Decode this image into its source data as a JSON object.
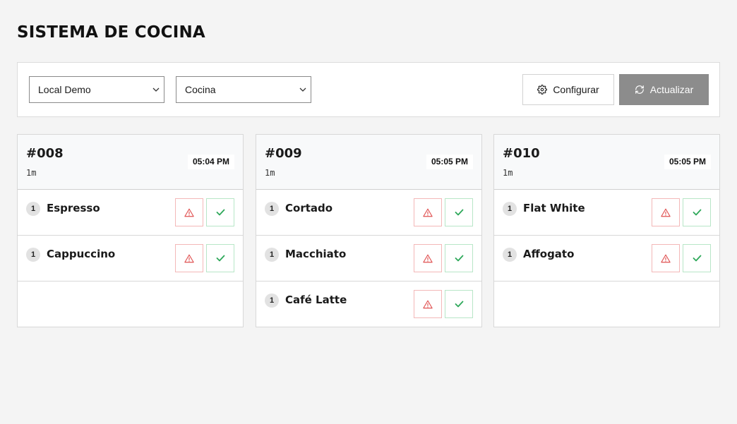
{
  "header": {
    "title": "SISTEMA DE COCINA"
  },
  "toolbar": {
    "location_select": {
      "value": "Local Demo"
    },
    "station_select": {
      "value": "Cocina"
    },
    "configure_label": "Configurar",
    "refresh_label": "Actualizar"
  },
  "colors": {
    "warn": "#e05252",
    "done": "#2ea85a",
    "refresh_bg": "#8c8c8c"
  },
  "icons": {
    "configure": "gear-icon",
    "refresh": "refresh-icon",
    "item_warn": "warning-triangle-icon",
    "item_done": "check-icon",
    "select_chevron": "chevron-down-icon"
  },
  "orders": [
    {
      "number": "#008",
      "age": "1m",
      "time": "05:04 PM",
      "items": [
        {
          "qty": "1",
          "name": "Espresso"
        },
        {
          "qty": "1",
          "name": "Cappuccino"
        }
      ]
    },
    {
      "number": "#009",
      "age": "1m",
      "time": "05:05 PM",
      "items": [
        {
          "qty": "1",
          "name": "Cortado"
        },
        {
          "qty": "1",
          "name": "Macchiato"
        },
        {
          "qty": "1",
          "name": "Café Latte"
        }
      ]
    },
    {
      "number": "#010",
      "age": "1m",
      "time": "05:05 PM",
      "items": [
        {
          "qty": "1",
          "name": "Flat White"
        },
        {
          "qty": "1",
          "name": "Affogato"
        }
      ]
    }
  ]
}
